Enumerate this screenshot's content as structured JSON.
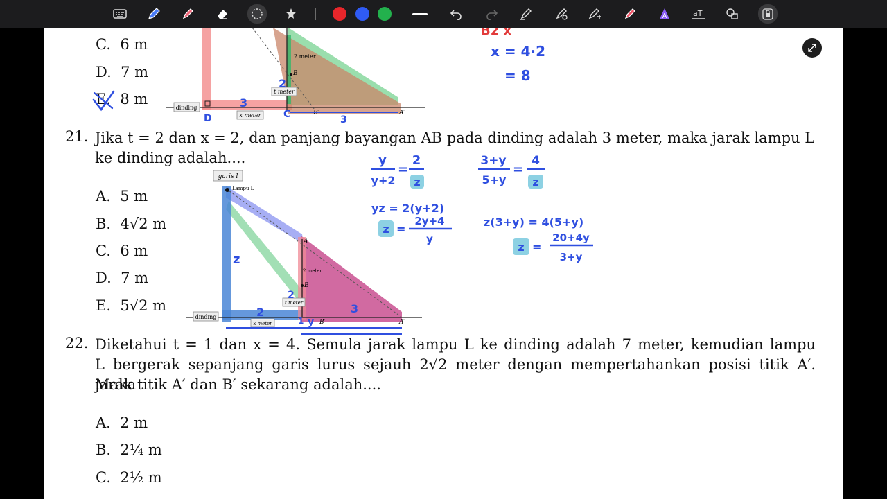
{
  "toolbar": {
    "tools": [
      "keyboard-icon",
      "pen-icon",
      "highlighter-icon",
      "eraser-icon",
      "lasso-icon",
      "shapes-icon"
    ],
    "colors": [
      "#e8262b",
      "#2f5bf5",
      "#23b14d"
    ],
    "actions": [
      "line-icon",
      "undo-icon",
      "redo-icon",
      "pen-settings-icon",
      "laser-pointer-icon",
      "ruler-icon",
      "marker-icon",
      "text-tool-icon",
      "text-recognition-icon",
      "shapes-tool-icon",
      "lock-icon"
    ]
  },
  "q20_options": [
    {
      "label": "C.",
      "text": "6 m"
    },
    {
      "label": "D.",
      "text": "7 m"
    },
    {
      "label": "E.",
      "text": "8 m"
    }
  ],
  "q20_handwriting": {
    "line1": "x = 4·2",
    "line2": "= 8",
    "marks": "B2 x"
  },
  "q20_diagram": {
    "wall": "dinding",
    "x_label": "x meter",
    "t_label": "t meter",
    "two_meter": "2 meter",
    "B": "B",
    "B_prime": "B′",
    "A_prime": "A′",
    "D": "D",
    "C": "C",
    "n3": "3",
    "n2": "2",
    "n3b": "3"
  },
  "q21": {
    "number": "21.",
    "line1": "Jika t = 2 dan x = 2, dan panjang bayangan AB pada dinding adalah 3 meter, maka jarak lampu L",
    "line2": "ke dinding adalah....",
    "options": [
      {
        "label": "A.",
        "text": "5 m"
      },
      {
        "label": "B.",
        "text": "4√2 m"
      },
      {
        "label": "C.",
        "text": "6 m"
      },
      {
        "label": "D.",
        "text": "7 m"
      },
      {
        "label": "E.",
        "text": "5√2 m"
      }
    ],
    "diagram": {
      "garis": "garis l",
      "lampu": "Lampu L",
      "A": "A",
      "B": "B",
      "two_meter": "2 meter",
      "t_meter": "t meter",
      "wall": "dinding",
      "x_meter": "x meter",
      "B_prime": "B′",
      "A_prime": "A′"
    },
    "handwriting": {
      "f1_num": "y",
      "f1_den": "y+2",
      "f1_rhs_num": "2",
      "f1_rhs_den": "z",
      "f2": "yz = 2(y+2)",
      "f3_lhs": "z",
      "f3_num": "2y+4",
      "f3_den": "y",
      "g1_num": "3+y",
      "g1_den": "5+y",
      "g1_rhs_num": "4",
      "g1_rhs_den": "z",
      "g2": "z(3+y) = 4(5+y)",
      "g3_lhs": "z",
      "g3_num": "20+4y",
      "g3_den": "3+y",
      "d_z": "z",
      "d_2": "2",
      "d_2b": "2",
      "d_3": "3",
      "d_1": "1",
      "d_y": "y"
    }
  },
  "q22": {
    "number": "22.",
    "line1": "Diketahui t = 1 dan x = 4.  Semula jarak lampu L ke dinding adalah 7 meter, kemudian lampu",
    "line2": "L bergerak sepanjang garis lurus sejauh 2√2 meter dengan mempertahankan posisi titik A′. Maka",
    "line3": "jarak titik A′ dan B′ sekarang adalah....",
    "options": [
      {
        "label": "A.",
        "text": "2 m"
      },
      {
        "label": "B.",
        "text": "2¼ m"
      },
      {
        "label": "C.",
        "text": "2½ m"
      }
    ]
  }
}
